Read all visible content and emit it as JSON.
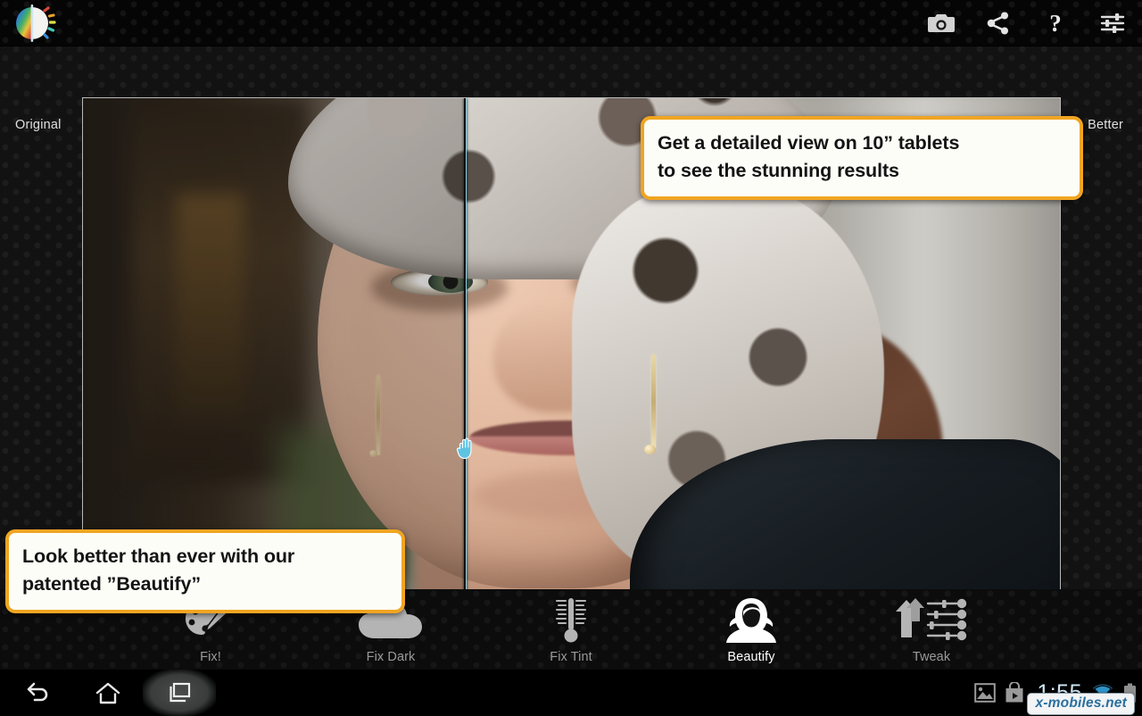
{
  "app": {
    "logo_icon": "color-balance-logo-icon"
  },
  "topbar": {
    "actions": [
      {
        "name": "camera",
        "icon": "camera-icon",
        "label": "Camera"
      },
      {
        "name": "share",
        "icon": "share-icon",
        "label": "Share"
      },
      {
        "name": "help",
        "icon": "question-mark-icon",
        "label": "?"
      },
      {
        "name": "settings",
        "icon": "sliders-icon",
        "label": "Settings"
      }
    ],
    "help_glyph": "?"
  },
  "stage": {
    "label_original": "Original",
    "label_better": "Better",
    "divider_position_percent": 39,
    "cursor_icon": "open-hand-cursor-icon"
  },
  "tooltips": [
    {
      "id": "tip-top",
      "line1": "Get a detailed view on 10” tablets",
      "line2": "to see the stunning results",
      "border_color": "#f0a522",
      "background_color": "#fdfdf8"
    },
    {
      "id": "tip-left",
      "line1": "Look better than ever with our",
      "line2": "patented ”Beautify”",
      "border_color": "#f0a522",
      "background_color": "#fdfdf8"
    }
  ],
  "toolbar": {
    "items": [
      {
        "label": "Fix!",
        "icon": "palette-brush-icon",
        "active": false
      },
      {
        "label": "Fix Dark",
        "icon": "cloud-icon",
        "active": false
      },
      {
        "label": "Fix Tint",
        "icon": "thermometer-icon",
        "active": false
      },
      {
        "label": "Beautify",
        "icon": "woman-portrait-icon",
        "active": true
      },
      {
        "label": "Tweak",
        "icon": "arrows-sliders-icon",
        "active": false
      }
    ],
    "active_color": "#ffffff",
    "inactive_color": "#9a9a9a"
  },
  "navbar": {
    "buttons": [
      {
        "name": "back",
        "icon": "back-arrow-icon"
      },
      {
        "name": "home",
        "icon": "home-icon"
      },
      {
        "name": "recent",
        "icon": "recent-apps-icon",
        "highlighted": true
      }
    ],
    "status": {
      "gallery_icon": "image-icon",
      "store_icon": "play-store-bag-icon",
      "clock": "1:55",
      "wifi_icon": "wifi-icon",
      "battery_icon": "battery-icon"
    }
  },
  "watermark": {
    "text": "x-mobiles.net"
  }
}
